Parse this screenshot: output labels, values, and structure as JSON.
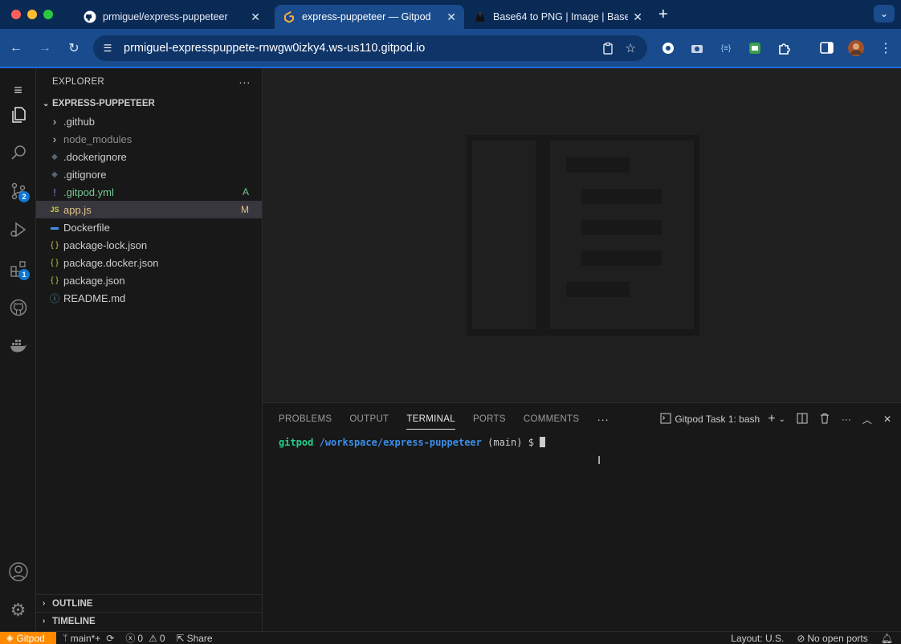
{
  "browser": {
    "tabs": [
      {
        "label": "prmiguel/express-puppeteer",
        "icon": "github-icon"
      },
      {
        "label": "express-puppeteer — Gitpod",
        "icon": "gitpod-icon",
        "active": true
      },
      {
        "label": "Base64 to PNG | Image | Base",
        "icon": "base64-site-icon"
      }
    ],
    "url": "prmiguel-expresspuppete-rnwgw0izky4.ws-us110.gitpod.io"
  },
  "explorer": {
    "title": "EXPLORER",
    "folder": "EXPRESS-PUPPETEER",
    "items": [
      {
        "label": ".github",
        "kind": "folder",
        "color": "#cccccc"
      },
      {
        "label": "node_modules",
        "kind": "folder",
        "color": "#8c8c8c"
      },
      {
        "label": ".dockerignore",
        "kind": "docker-ignore",
        "color": "#cccccc"
      },
      {
        "label": ".gitignore",
        "kind": "git",
        "color": "#cccccc"
      },
      {
        "label": ".gitpod.yml",
        "kind": "yaml",
        "color": "#73c991",
        "status": "A"
      },
      {
        "label": "app.js",
        "kind": "js",
        "color": "#e2c08d",
        "status": "M",
        "selected": true
      },
      {
        "label": "Dockerfile",
        "kind": "docker",
        "color": "#cccccc"
      },
      {
        "label": "package-lock.json",
        "kind": "json",
        "color": "#cccccc"
      },
      {
        "label": "package.docker.json",
        "kind": "json",
        "color": "#cccccc"
      },
      {
        "label": "package.json",
        "kind": "json",
        "color": "#cccccc"
      },
      {
        "label": "README.md",
        "kind": "info",
        "color": "#cccccc"
      }
    ],
    "outline": "OUTLINE",
    "timeline": "TIMELINE"
  },
  "activity": {
    "scm_badge": "2",
    "extensions_badge": "1"
  },
  "panel": {
    "tabs": [
      "PROBLEMS",
      "OUTPUT",
      "TERMINAL",
      "PORTS",
      "COMMENTS"
    ],
    "active_tab": "TERMINAL",
    "terminal_name": "Gitpod Task 1: bash",
    "prompt_user": "gitpod",
    "prompt_path": "/workspace/express-puppeteer",
    "prompt_branch": "(main) $"
  },
  "statusbar": {
    "remote": "Gitpod",
    "branch": "main*+",
    "errors": "0",
    "warnings": "0",
    "share": "Share",
    "layout": "Layout: U.S.",
    "ports": "No open ports"
  },
  "colors": {
    "accent": "#0e78d4",
    "remote": "#ff8a00",
    "prompt_green": "#23d18b",
    "prompt_blue": "#3b8eea"
  }
}
